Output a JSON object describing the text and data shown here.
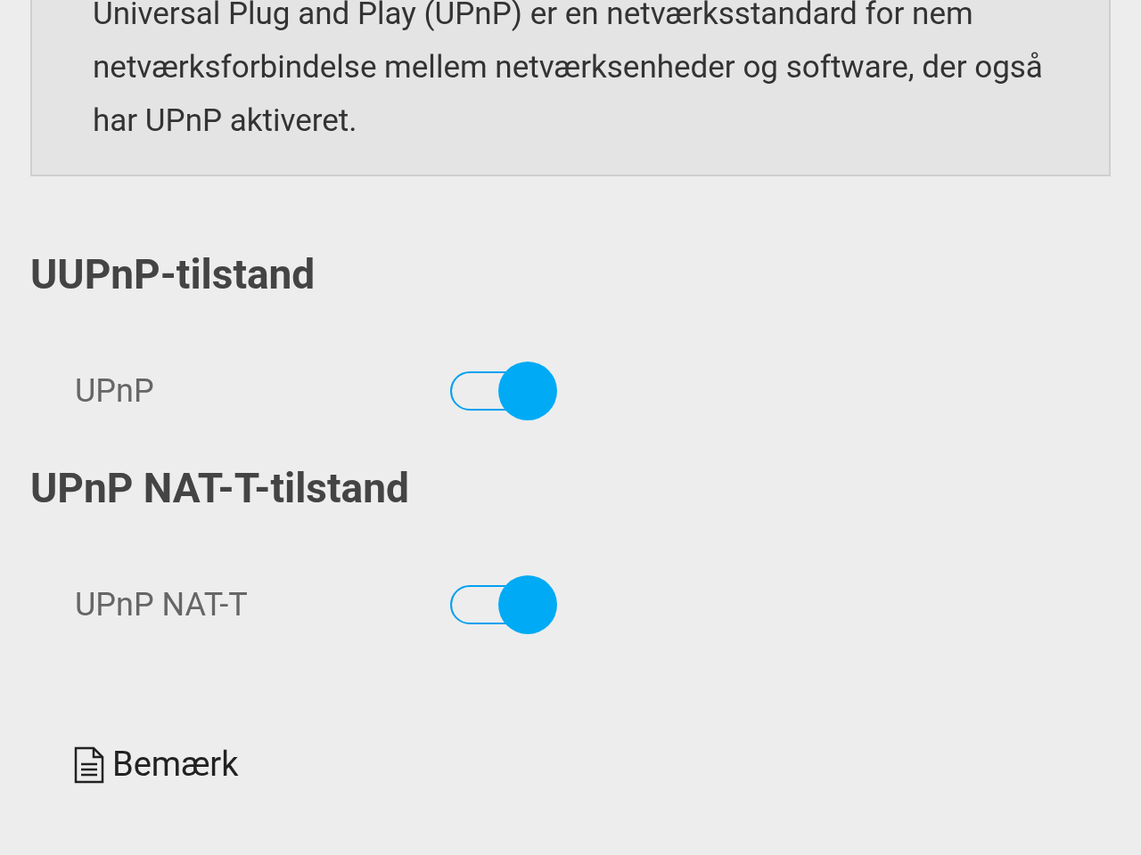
{
  "info_box": {
    "text": "Universal Plug and Play (UPnP) er en netværksstandard for nem netværksforbindelse mellem netværksenheder og software, der også har UPnP aktiveret."
  },
  "sections": [
    {
      "heading": "UUPnP-tilstand",
      "setting": {
        "label": "UPnP",
        "on": true
      }
    },
    {
      "heading": "UPnP NAT-T-tilstand",
      "setting": {
        "label": "UPnP NAT-T",
        "on": true
      }
    }
  ],
  "note": {
    "label": "Bemærk"
  }
}
